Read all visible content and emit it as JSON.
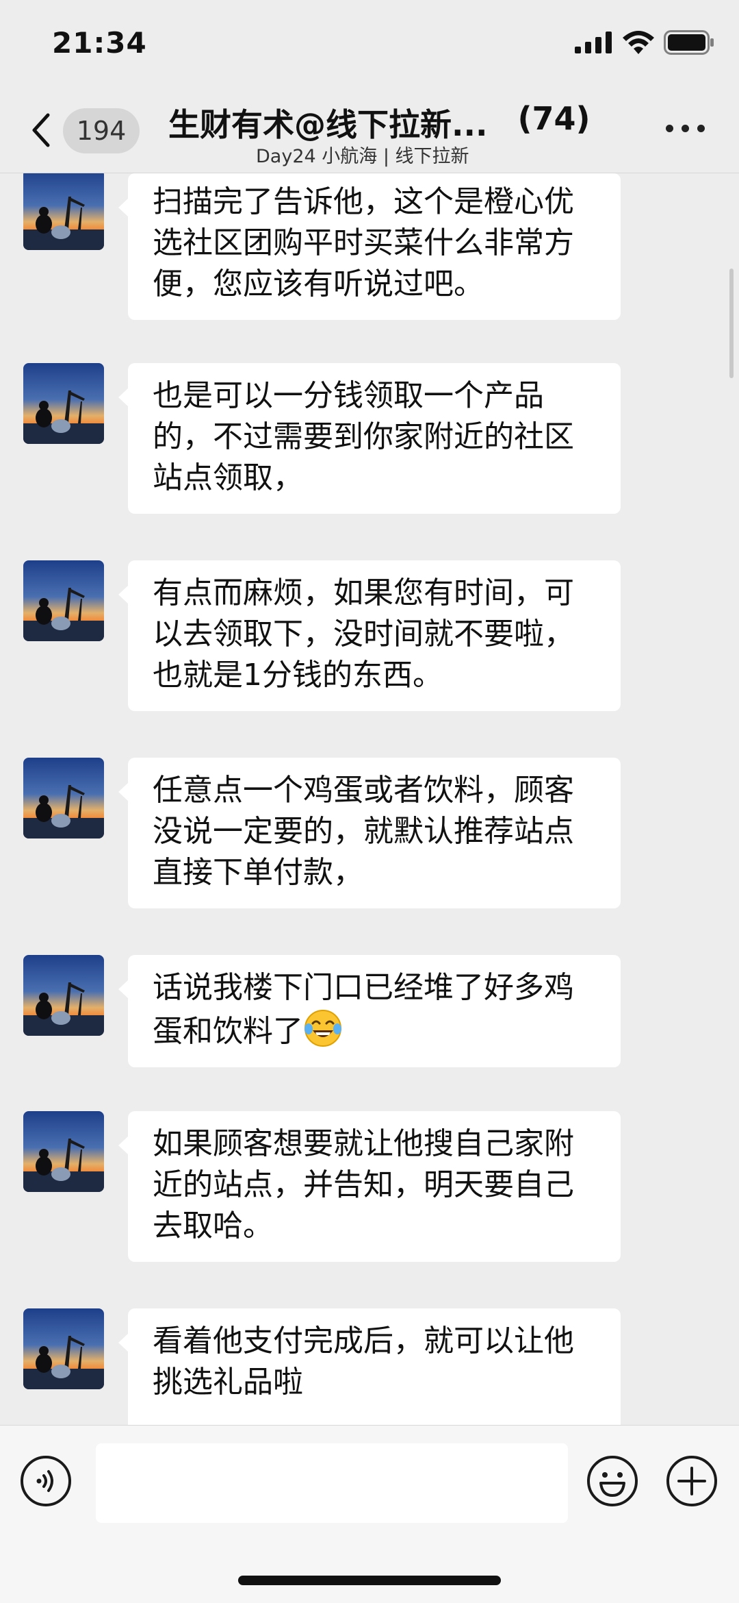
{
  "status_bar": {
    "time": "21:34",
    "icons": [
      "signal-icon",
      "wifi-icon",
      "battery-icon"
    ]
  },
  "header": {
    "back_icon": "chevron-left-icon",
    "unread_count": "194",
    "title": "生财有术@线下拉新...",
    "member_count": "(74)",
    "subtitle": "Day24 小航海 | 线下拉新",
    "more_icon": "more-dots-icon"
  },
  "messages": [
    {
      "text": "扫描完了告诉他，这个是橙心优选社区团购平时买菜什么非常方便，您应该有听说过吧。"
    },
    {
      "text": "也是可以一分钱领取一个产品的，不过需要到你家附近的社区站点领取，"
    },
    {
      "text": "有点而麻烦，如果您有时间，可以去领取下，没时间就不要啦，也就是1分钱的东西。"
    },
    {
      "text": "任意点一个鸡蛋或者饮料，顾客没说一定要的，就默认推荐站点直接下单付款，"
    },
    {
      "text": "话说我楼下门口已经堆了好多鸡蛋和饮料了",
      "emoji": "laughing-tears-emoji"
    },
    {
      "text": "如果顾客想要就让他搜自己家附近的站点，并告知，明天要自己去取哈。"
    },
    {
      "text": "看着他支付完成后，就可以让他挑选礼品啦"
    }
  ],
  "input_bar": {
    "voice_icon": "voice-icon",
    "input_value": "",
    "emoji_icon": "smiley-icon",
    "add_icon": "plus-icon"
  },
  "colors": {
    "background": "#ededed",
    "bubble": "#ffffff",
    "input_bar": "#f6f6f6"
  }
}
